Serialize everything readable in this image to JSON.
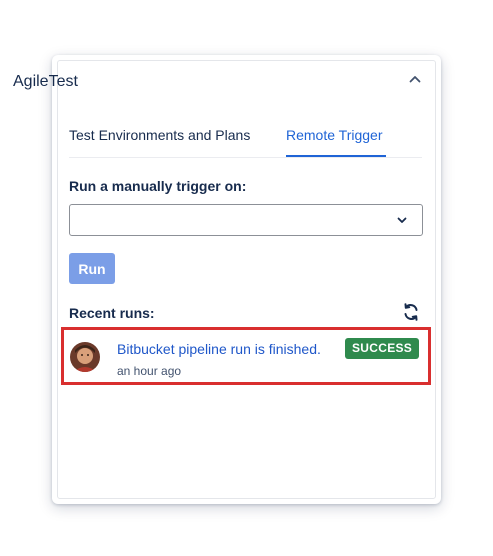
{
  "header": {
    "title": "AgileTest"
  },
  "tabs": [
    {
      "label": "Test Environments and Plans",
      "active": false
    },
    {
      "label": "Remote Trigger",
      "active": true
    }
  ],
  "trigger": {
    "label": "Run a manually trigger on:",
    "select_value": ""
  },
  "run_button": {
    "label": "Run"
  },
  "recent": {
    "label": "Recent runs:",
    "items": [
      {
        "title": "Bitbucket pipeline run is finished.",
        "status": "SUCCESS",
        "time": "an hour ago"
      }
    ]
  },
  "icons": {
    "collapse": "chevron-up-icon",
    "select": "chevron-down-icon",
    "refresh": "refresh-icon",
    "avatar": "user-avatar"
  },
  "colors": {
    "accent": "#1f64d6",
    "run_button": "#7b9ee7",
    "success": "#2f8a4d",
    "highlight": "#d92f2f",
    "link": "#1f57c9"
  }
}
